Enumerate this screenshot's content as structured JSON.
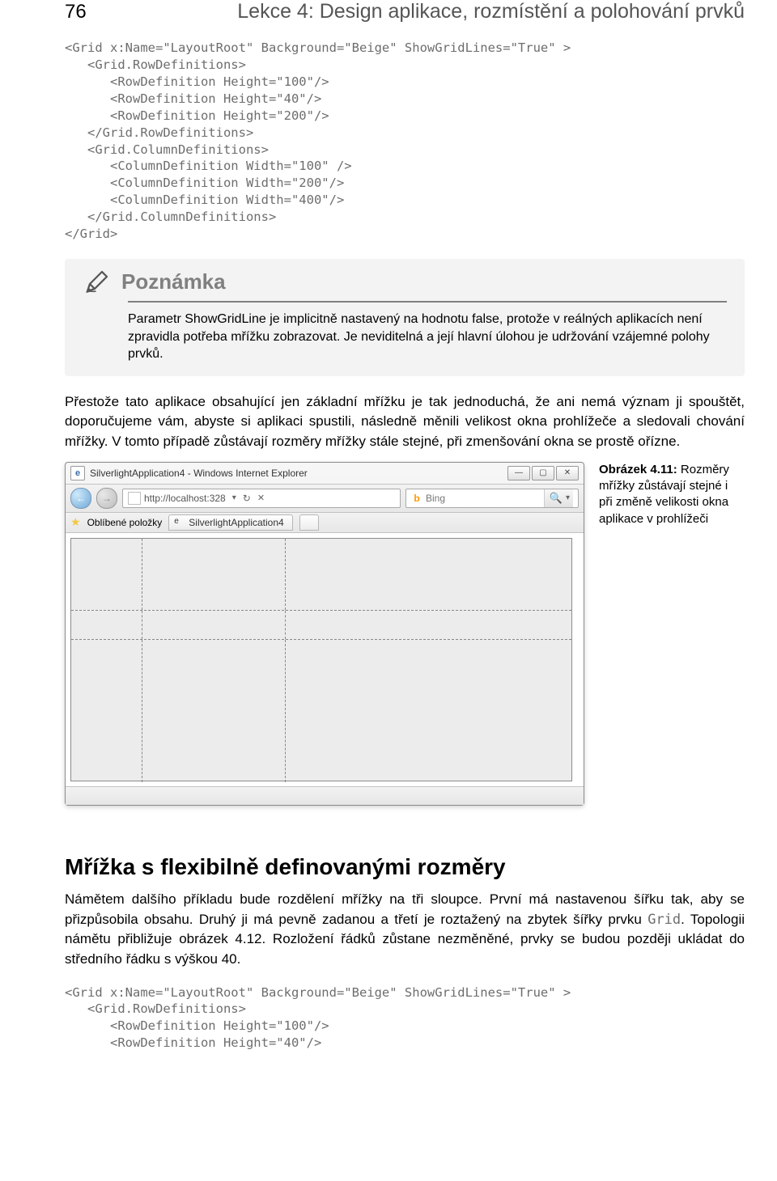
{
  "header": {
    "page_number": "76",
    "chapter": "Lekce 4: Design aplikace, rozmístění a polohování prvků"
  },
  "code1": {
    "lines": [
      "<Grid x:Name=\"LayoutRoot\" Background=\"Beige\" ShowGridLines=\"True\" >",
      "   <Grid.RowDefinitions>",
      "      <RowDefinition Height=\"100\"/>",
      "      <RowDefinition Height=\"40\"/>",
      "      <RowDefinition Height=\"200\"/>",
      "   </Grid.RowDefinitions>",
      "   <Grid.ColumnDefinitions>",
      "      <ColumnDefinition Width=\"100\" />",
      "      <ColumnDefinition Width=\"200\"/>",
      "      <ColumnDefinition Width=\"400\"/>",
      "   </Grid.ColumnDefinitions>",
      "</Grid>"
    ]
  },
  "note": {
    "title": "Poznámka",
    "body": "Parametr ShowGridLine je implicitně nastavený na hodnotu false, protože v reálných aplikacích není zpravidla potřeba mřížku zobrazovat. Je neviditelná a její hlavní úlohou je udržování vzájemné polohy prvků."
  },
  "para1": "Přestože tato aplikace obsahující jen základní mřížku je tak jednoduchá, že ani nemá význam ji spouštět, doporučujeme vám, abyste si aplikaci spustili, následně měnili velikost okna prohlížeče a sledovali chování mřížky. V tomto případě zůstávají rozměry mřížky stále stejné, při zmenšování okna se prostě ořízne.",
  "browser": {
    "title": "SilverlightApplication4 - Windows Internet Explorer",
    "url": "http://localhost:328",
    "search_placeholder": "Bing",
    "fav_label": "Oblíbené položky",
    "tab_label": "SilverlightApplication4",
    "grid": {
      "cols": [
        100,
        200,
        400
      ],
      "rows": [
        100,
        40,
        200
      ]
    }
  },
  "figure": {
    "label": "Obrázek 4.11:",
    "caption": "Rozměry mřížky zůstávají stejné i při změně velikosti okna aplikace v prohlížeči"
  },
  "section2": {
    "title": "Mřížka s flexibilně definovanými rozměry",
    "para_a": "Námětem dalšího příkladu bude rozdělení mřížky na tři sloupce. První má nastavenou šířku tak, aby se přizpůsobila obsahu. Druhý ji má pevně zadanou a třetí je roztažený na zbytek šířky prvku ",
    "para_a_code": "Grid",
    "para_a_end": ". Topologii námětu přibližuje obrázek 4.12. Rozložení řádků zůstane nezměněné, prvky se budou později ukládat do středního řádku s výškou 40."
  },
  "code2": {
    "lines": [
      "<Grid x:Name=\"LayoutRoot\" Background=\"Beige\" ShowGridLines=\"True\" >",
      "   <Grid.RowDefinitions>",
      "      <RowDefinition Height=\"100\"/>",
      "      <RowDefinition Height=\"40\"/>"
    ]
  }
}
